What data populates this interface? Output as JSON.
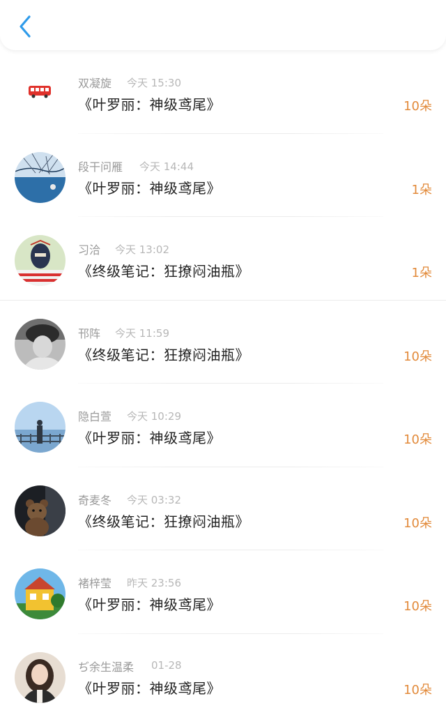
{
  "header": {
    "back_icon": "chevron-left-icon",
    "accent": "#2f9bea"
  },
  "colors": {
    "amount": "#e28a3a",
    "name": "#9a9a9a",
    "time": "#b7b7b7",
    "title": "#222222"
  },
  "items": [
    {
      "name": "双凝旋",
      "time": "今天 15:30",
      "title": "《叶罗丽：神级鸢尾》",
      "amount": "10朵",
      "avatar": "red-bus-icon"
    },
    {
      "name": "段干问雁",
      "time": "今天 14:44",
      "title": "《叶罗丽：神级鸢尾》",
      "amount": "1朵",
      "avatar": "winter-tree-lake-photo"
    },
    {
      "name": "习洽",
      "time": "今天 13:02",
      "title": "《终级笔记：狂撩闷油瓶》",
      "amount": "1朵",
      "avatar": "masked-figure-photo"
    },
    {
      "name": "邗阵",
      "time": "今天 11:59",
      "title": "《终级笔记：狂撩闷油瓶》",
      "amount": "10朵",
      "avatar": "bw-portrait-photo"
    },
    {
      "name": "隐白萱",
      "time": "今天 10:29",
      "title": "《叶罗丽：神级鸢尾》",
      "amount": "10朵",
      "avatar": "seaside-figure-photo"
    },
    {
      "name": "奇麦冬",
      "time": "今天 03:32",
      "title": "《终级笔记：狂撩闷油瓶》",
      "amount": "10朵",
      "avatar": "teddy-bear-photo"
    },
    {
      "name": "褚梓莹",
      "time": "昨天 23:56",
      "title": "《叶罗丽：神级鸢尾》",
      "amount": "10朵",
      "avatar": "yellow-house-photo"
    },
    {
      "name": "ぢ余生温柔",
      "time": "01-28",
      "title": "《叶罗丽：神级鸢尾》",
      "amount": "10朵",
      "avatar": "woman-portrait-photo"
    }
  ]
}
